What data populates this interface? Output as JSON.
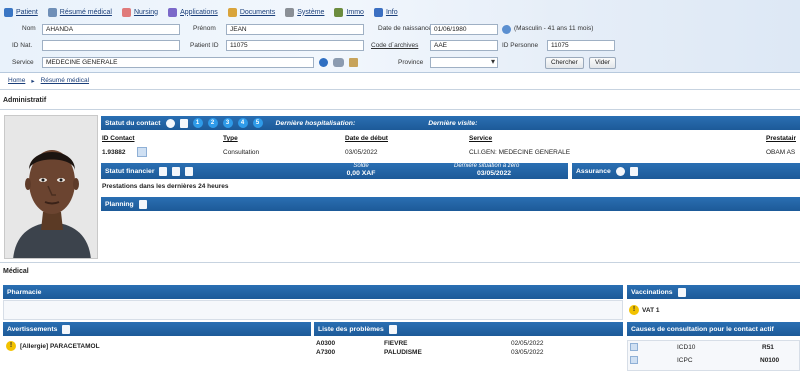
{
  "menu": [
    {
      "label": "Patient",
      "icon": "patient-icon",
      "color": "#3a76c4"
    },
    {
      "label": "Résumé médical",
      "icon": "summary-icon",
      "color": "#6f8fb7"
    },
    {
      "label": "Nursing",
      "icon": "nursing-icon",
      "color": "#e07a7a"
    },
    {
      "label": "Applications",
      "icon": "applications-icon",
      "color": "#7b68c9"
    },
    {
      "label": "Documents",
      "icon": "documents-icon",
      "color": "#d9a43b"
    },
    {
      "label": "Système",
      "icon": "system-icon",
      "color": "#8a8f96"
    },
    {
      "label": "Immo",
      "icon": "immo-icon",
      "color": "#6c8c3e"
    },
    {
      "label": "Info",
      "icon": "info-icon",
      "color": "#3b6fc2"
    }
  ],
  "search": {
    "nom_label": "Nom",
    "nom_value": "AHANDA",
    "prenom_label": "Prénom",
    "prenom_value": "JEAN",
    "dob_label": "Date de naissance",
    "dob_value": "01/06/1980",
    "dob_info": "(Masculin - 41 ans 11 mois)",
    "idnat_label": "ID Nat.",
    "idnat_value": "",
    "patientid_label": "Patient ID",
    "patientid_value": "11075",
    "archives_label": "Code d´archives",
    "archives_value": "AAE",
    "idpersonne_label": "ID Personne",
    "idpersonne_value": "11075",
    "service_label": "Service",
    "service_value": "MEDECINE GENERALE",
    "province_label": "Province",
    "province_value": "",
    "search_button": "Chercher",
    "clear_button": "Vider"
  },
  "breadcrumb": [
    "Home",
    "Résumé médical"
  ],
  "admin": {
    "title": "Administratif",
    "contact_bar": {
      "title": "Statut du contact",
      "numbers": [
        "1",
        "2",
        "3",
        "4",
        "5"
      ],
      "last_hosp": "Dernière hospitalisation:",
      "last_visit": "Dernière visite:"
    },
    "contact_table": {
      "headers": [
        "ID Contact",
        "Type",
        "Date de début",
        "Service",
        "Prestatair"
      ],
      "row": [
        "1.93882",
        "Consultation",
        "03/05/2022",
        "CLI.GEN: MEDECINE GENERALE",
        "OBAM AS"
      ]
    },
    "finance": {
      "title": "Statut financier",
      "solde_label": "Solde",
      "solde_value": "0,00 XAF",
      "last_zero_label": "Dernière situation à zéro",
      "last_zero_value": "03/05/2022",
      "prestations": "Prestations dans les dernières 24 heures"
    },
    "assurance": {
      "title": "Assurance"
    },
    "planning": {
      "title": "Planning"
    }
  },
  "medical": {
    "title": "Médical",
    "pharmacie": {
      "title": "Pharmacie"
    },
    "vaccinations": {
      "title": "Vaccinations",
      "item": "VAT 1"
    },
    "warnings": {
      "title": "Avertissements",
      "item": "[Allergie] PARACETAMOL"
    },
    "problems": {
      "title": "Liste des problèmes",
      "rows": [
        {
          "code": "A0300",
          "label": "FIEVRE",
          "date": "02/05/2022"
        },
        {
          "code": "A7300",
          "label": "PALUDISME",
          "date": "03/05/2022"
        }
      ]
    },
    "causes": {
      "title": "Causes de consultation pour le contact actif",
      "rows": [
        {
          "system": "ICD10",
          "code": "R51"
        },
        {
          "system": "ICPC",
          "code": "N0100"
        }
      ]
    }
  },
  "colors": {
    "bar": "#2a6fb3",
    "badge": "#2f9be9",
    "link": "#1b3f7a",
    "warning": "#f2c200"
  }
}
